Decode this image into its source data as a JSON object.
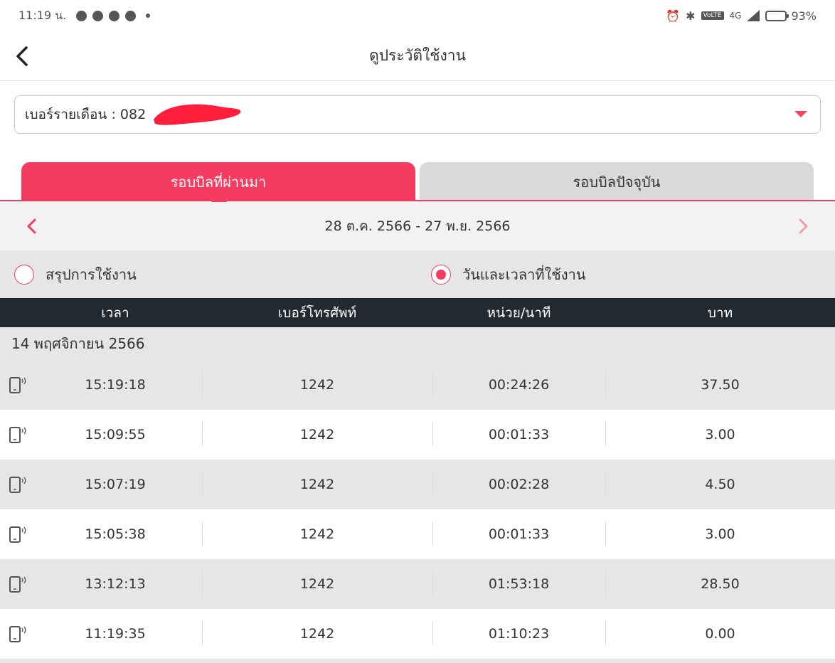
{
  "status_bar": {
    "time": "11:19 น.",
    "network": "4G",
    "battery": "93%",
    "battery_level": 0.93,
    "icons": [
      "chat-bubble-icon",
      "messenger-icon",
      "line-icon",
      "messenger-icon",
      "alarm-icon",
      "bluetooth-icon",
      "volte-icon",
      "signal-icon",
      "battery-icon"
    ]
  },
  "header": {
    "title": "ดูประวัติใช้งาน"
  },
  "number_select": {
    "label": "เบอร์รายเดือน : 082"
  },
  "tabs": [
    {
      "label": "รอบบิลที่ผ่านมา",
      "active": true
    },
    {
      "label": "รอบบิลปัจจุบัน",
      "active": false
    }
  ],
  "period": {
    "range": "28 ต.ค. 2566 - 27 พ.ย. 2566"
  },
  "view_options": [
    {
      "label": "สรุปการใช้งาน",
      "selected": false
    },
    {
      "label": "วันและเวลาที่ใช้งาน",
      "selected": true
    }
  ],
  "table": {
    "columns": [
      "เวลา",
      "เบอร์โทรศัพท์",
      "หน่วย/นาที",
      "บาท"
    ],
    "date_group": "14 พฤศจิกายน 2566",
    "rows": [
      {
        "time": "15:19:18",
        "number": "1242",
        "duration": "00:24:26",
        "amount": "37.50"
      },
      {
        "time": "15:09:55",
        "number": "1242",
        "duration": "00:01:33",
        "amount": "3.00"
      },
      {
        "time": "15:07:19",
        "number": "1242",
        "duration": "00:02:28",
        "amount": "4.50"
      },
      {
        "time": "15:05:38",
        "number": "1242",
        "duration": "00:01:33",
        "amount": "3.00"
      },
      {
        "time": "13:12:13",
        "number": "1242",
        "duration": "01:53:18",
        "amount": "28.50"
      },
      {
        "time": "11:19:35",
        "number": "1242",
        "duration": "01:10:23",
        "amount": "0.00"
      }
    ]
  },
  "colors": {
    "accent": "#f53c60",
    "table_header": "#222930",
    "row_alt": "#e6e6e6",
    "tab_inactive": "#d9d9db"
  }
}
